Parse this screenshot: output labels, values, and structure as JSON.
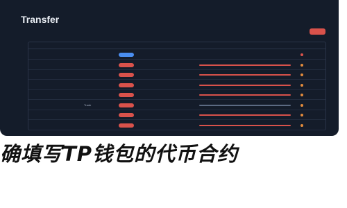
{
  "panel": {
    "title": "Transfer",
    "action_label": "",
    "accent_color": "#d9524b",
    "background_color": "#141c2a"
  },
  "table": {
    "headers": [
      "",
      "",
      "",
      "",
      "",
      "",
      ""
    ],
    "rows": [
      {
        "idx": "",
        "hash": "",
        "method": "",
        "pill_color": "#4a8ef0",
        "age": "",
        "bar_color": "#5c6a82",
        "token": "",
        "token_color": "#d9524b"
      },
      {
        "idx": "",
        "hash": "",
        "method": "",
        "pill_color": "#d9524b",
        "age": "",
        "bar_color": "#d9524b",
        "token": "",
        "token_color": "#e08a3c"
      },
      {
        "idx": "",
        "hash": "",
        "method": "",
        "pill_color": "#d9524b",
        "age": "",
        "bar_color": "#d9524b",
        "token": "",
        "token_color": "#e08a3c"
      },
      {
        "idx": "",
        "hash": "",
        "method": "",
        "pill_color": "#d9524b",
        "age": "",
        "bar_color": "#d9524b",
        "token": "",
        "token_color": "#e08a3c"
      },
      {
        "idx": "",
        "hash": "",
        "method": "",
        "pill_color": "#d9524b",
        "age": "",
        "bar_color": "#d9524b",
        "token": "",
        "token_color": "#e08a3c"
      },
      {
        "idx": "",
        "hash": "",
        "method": "Trade",
        "pill_color": "#d9524b",
        "age": "",
        "bar_color": "#5c6a82",
        "token": "",
        "token_color": "#e08a3c"
      },
      {
        "idx": "",
        "hash": "",
        "method": "",
        "pill_color": "#d9524b",
        "age": "",
        "bar_color": "#d9524b",
        "token": "",
        "token_color": "#e08a3c"
      },
      {
        "idx": "",
        "hash": "",
        "method": "",
        "pill_color": "#d9524b",
        "age": "",
        "bar_color": "#d9524b",
        "token": "",
        "token_color": "#e08a3c"
      }
    ]
  },
  "caption": {
    "text": "确填写TP钱包的代币合约"
  }
}
